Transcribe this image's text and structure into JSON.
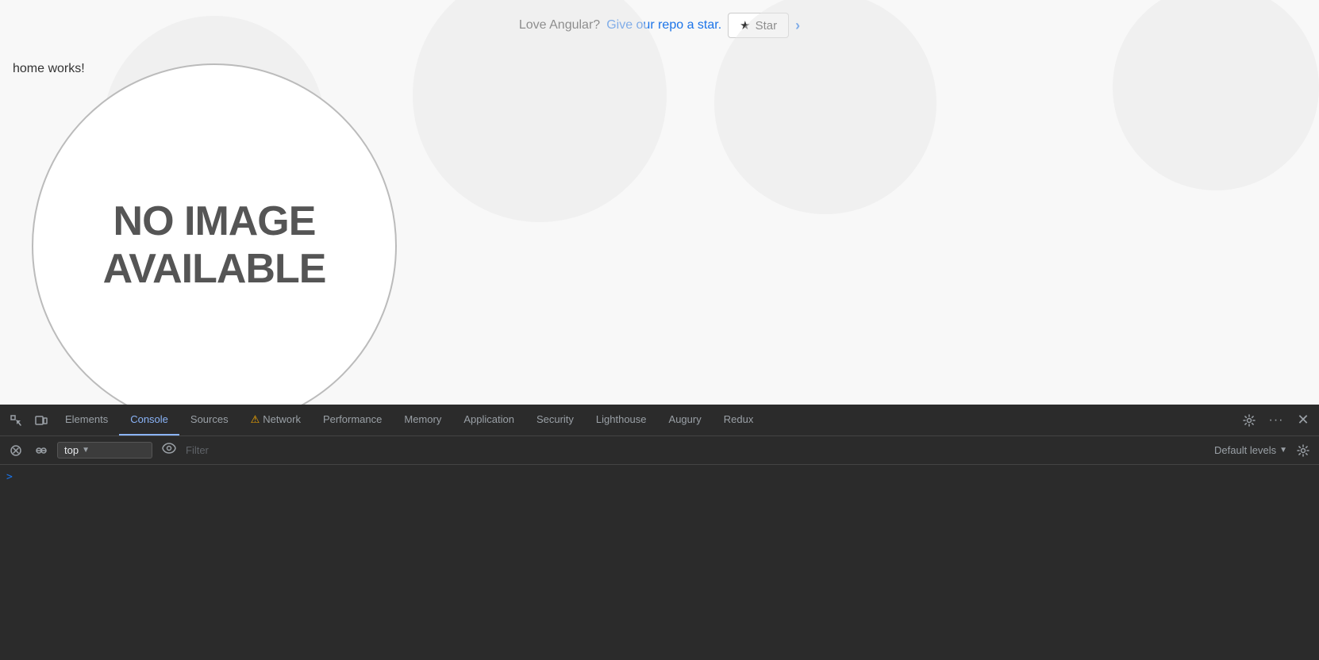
{
  "page": {
    "background_color": "#f8f8f8"
  },
  "banner": {
    "text": "Love Angular?",
    "link_text": "Give our repo a star.",
    "star_button_label": "Star",
    "chevron": "›"
  },
  "main_content": {
    "home_works": "home works!",
    "no_image_line1": "NO IMAGE",
    "no_image_line2": "AVAILABLE"
  },
  "devtools": {
    "tabs": [
      {
        "id": "elements",
        "label": "Elements",
        "active": false,
        "warning": false
      },
      {
        "id": "console",
        "label": "Console",
        "active": true,
        "warning": false
      },
      {
        "id": "sources",
        "label": "Sources",
        "active": false,
        "warning": false
      },
      {
        "id": "network",
        "label": "Network",
        "active": false,
        "warning": true
      },
      {
        "id": "performance",
        "label": "Performance",
        "active": false,
        "warning": false
      },
      {
        "id": "memory",
        "label": "Memory",
        "active": false,
        "warning": false
      },
      {
        "id": "application",
        "label": "Application",
        "active": false,
        "warning": false
      },
      {
        "id": "security",
        "label": "Security",
        "active": false,
        "warning": false
      },
      {
        "id": "lighthouse",
        "label": "Lighthouse",
        "active": false,
        "warning": false
      },
      {
        "id": "augury",
        "label": "Augury",
        "active": false,
        "warning": false
      },
      {
        "id": "redux",
        "label": "Redux",
        "active": false,
        "warning": false
      }
    ],
    "console_toolbar": {
      "context_value": "top",
      "filter_placeholder": "Filter",
      "default_levels_label": "Default levels"
    },
    "prompt_arrow": ">"
  }
}
